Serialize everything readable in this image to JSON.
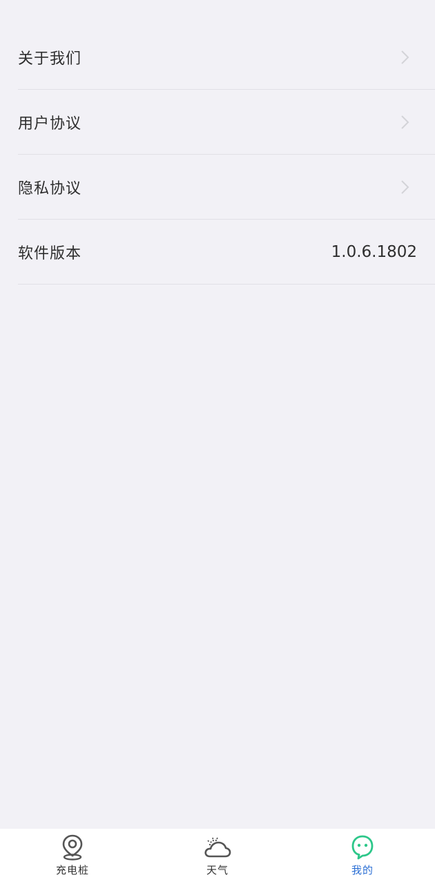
{
  "settings": {
    "items": [
      {
        "label": "关于我们"
      },
      {
        "label": "用户协议"
      },
      {
        "label": "隐私协议"
      },
      {
        "label": "软件版本",
        "value": "1.0.6.1802"
      }
    ]
  },
  "tabbar": {
    "tabs": [
      {
        "label": "充电桩",
        "icon": "location-pin-icon"
      },
      {
        "label": "天气",
        "icon": "weather-cloud-icon"
      },
      {
        "label": "我的",
        "icon": "profile-face-icon",
        "active": true
      }
    ]
  },
  "colors": {
    "background": "#f2f1f6",
    "active_tab_text": "#2b6fd4",
    "active_tab_icon": "#2dc78a",
    "text": "#2e2e2e"
  }
}
